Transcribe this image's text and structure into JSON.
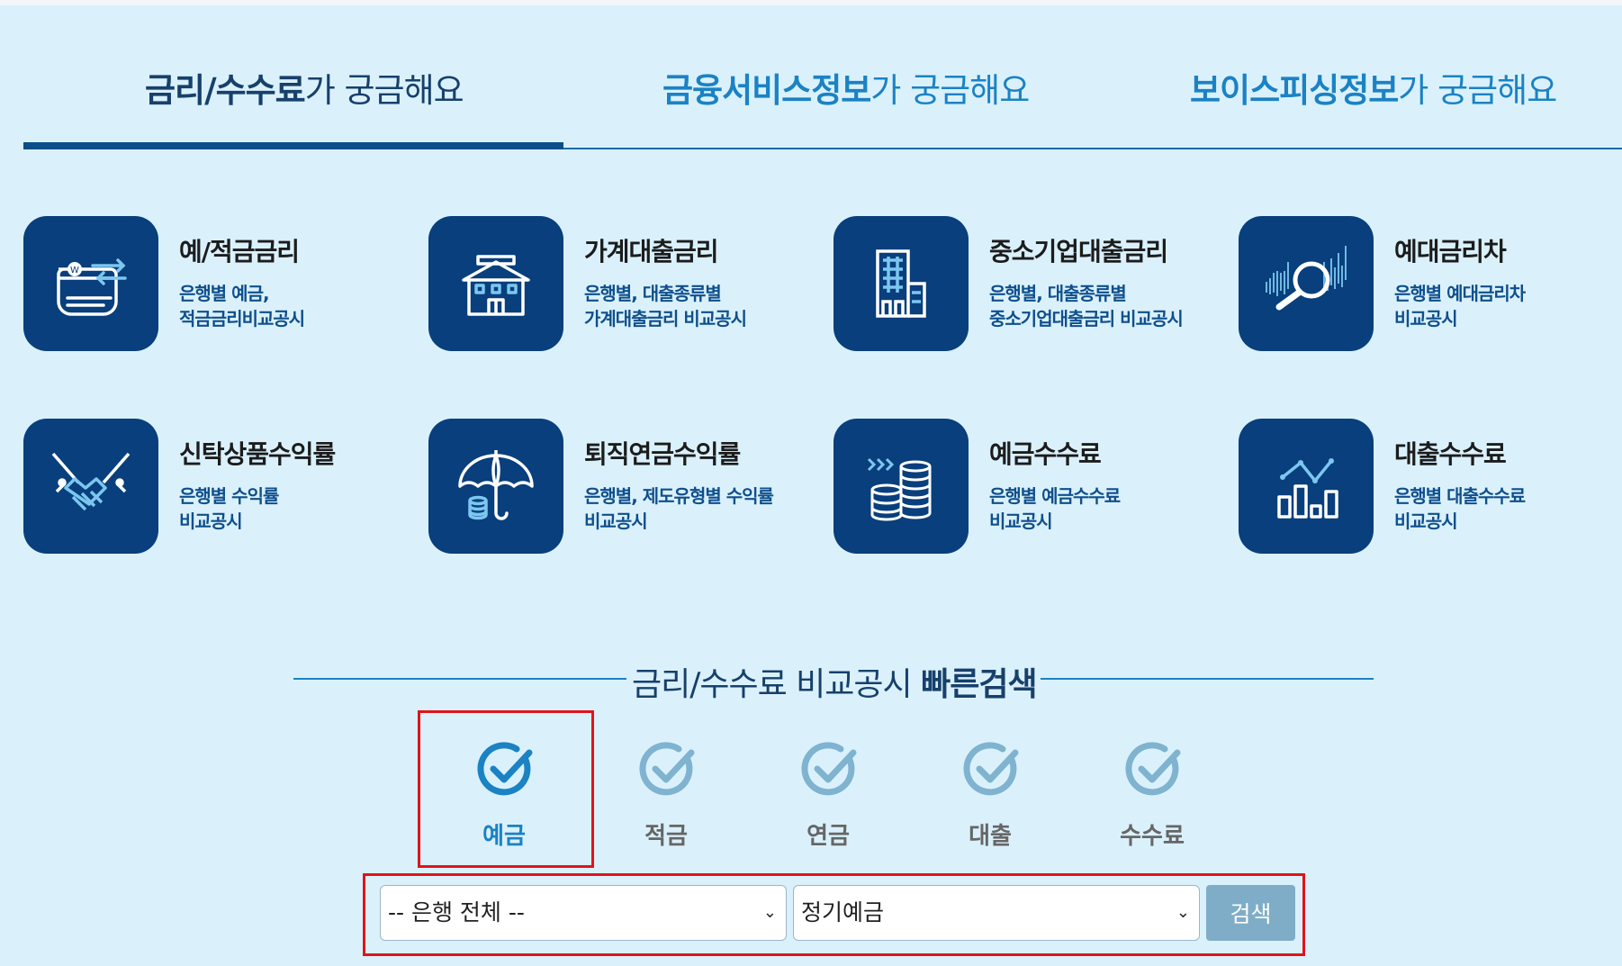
{
  "tabs": [
    {
      "strong": "금리/수수료",
      "rest": "가 궁금해요"
    },
    {
      "strong": "금융서비스정보",
      "rest": "가 궁금해요"
    },
    {
      "strong": "보이스피싱정보",
      "rest": "가 궁금해요"
    }
  ],
  "cards": [
    {
      "title": "예/적금금리",
      "desc1": "은행별 예금,",
      "desc2": "적금금리비교공시",
      "icon": "deposit-card-icon"
    },
    {
      "title": "가계대출금리",
      "desc1": "은행별, 대출종류별",
      "desc2": "가계대출금리 비교공시",
      "icon": "house-icon"
    },
    {
      "title": "중소기업대출금리",
      "desc1": "은행별, 대출종류별",
      "desc2": "중소기업대출금리 비교공시",
      "icon": "office-building-icon"
    },
    {
      "title": "예대금리차",
      "desc1": "은행별 예대금리차",
      "desc2": "비교공시",
      "icon": "magnifier-chart-icon"
    },
    {
      "title": "신탁상품수익률",
      "desc1": "은행별 수익률",
      "desc2": "비교공시",
      "icon": "handshake-icon"
    },
    {
      "title": "퇴직연금수익률",
      "desc1": "은행별, 제도유형별 수익률",
      "desc2": "비교공시",
      "icon": "umbrella-coins-icon"
    },
    {
      "title": "예금수수료",
      "desc1": "은행별 예금수수료",
      "desc2": "비교공시",
      "icon": "coin-stack-icon"
    },
    {
      "title": "대출수수료",
      "desc1": "은행별 대출수수료",
      "desc2": "비교공시",
      "icon": "bar-chart-icon"
    }
  ],
  "quick_search": {
    "title_normal": "금리/수수료 비교공시 ",
    "title_strong": "빠른검색",
    "options": [
      "예금",
      "적금",
      "연금",
      "대출",
      "수수료"
    ],
    "bank_select": "-- 은행 전체 --",
    "product_select": "정기예금",
    "search_button": "검색"
  },
  "colors": {
    "background": "#daf1fc",
    "icon_box": "#083f7c",
    "accent_blue": "#1b82c4",
    "highlight_red": "#e0141b"
  }
}
